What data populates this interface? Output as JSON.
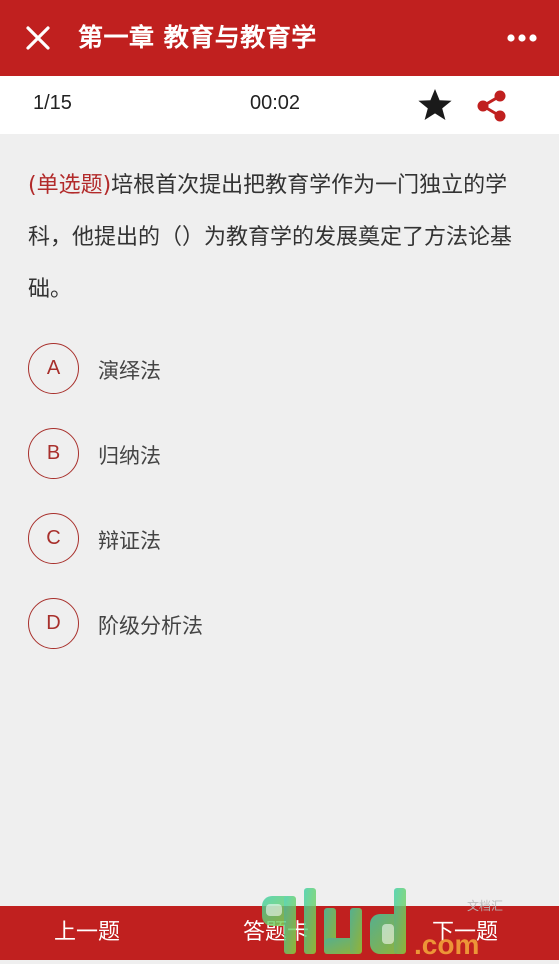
{
  "header": {
    "title": "第一章 教育与教育学",
    "close_icon": "close-icon",
    "more_icon": "more-dots-icon"
  },
  "status": {
    "progress": "1/15",
    "timer": "00:02",
    "favorite_icon": "star-icon",
    "share_icon": "share-icon"
  },
  "question": {
    "type_label": "(单选题)",
    "text": "培根首次提出把教育学作为一门独立的学科，他提出的（）为教育学的发展奠定了方法论基础。"
  },
  "options": [
    {
      "letter": "A",
      "text": "演绎法"
    },
    {
      "letter": "B",
      "text": "归纳法"
    },
    {
      "letter": "C",
      "text": "辩证法"
    },
    {
      "letter": "D",
      "text": "阶级分析法"
    }
  ],
  "footer": {
    "prev_label": "上一题",
    "card_label": "答题卡",
    "next_label": "下一题"
  },
  "watermark": {
    "brand": "9lud",
    "domain": ".com",
    "small_text": "文档汇"
  },
  "colors": {
    "primary": "#c0201f",
    "accent": "#a8302c",
    "background": "#efefef"
  }
}
